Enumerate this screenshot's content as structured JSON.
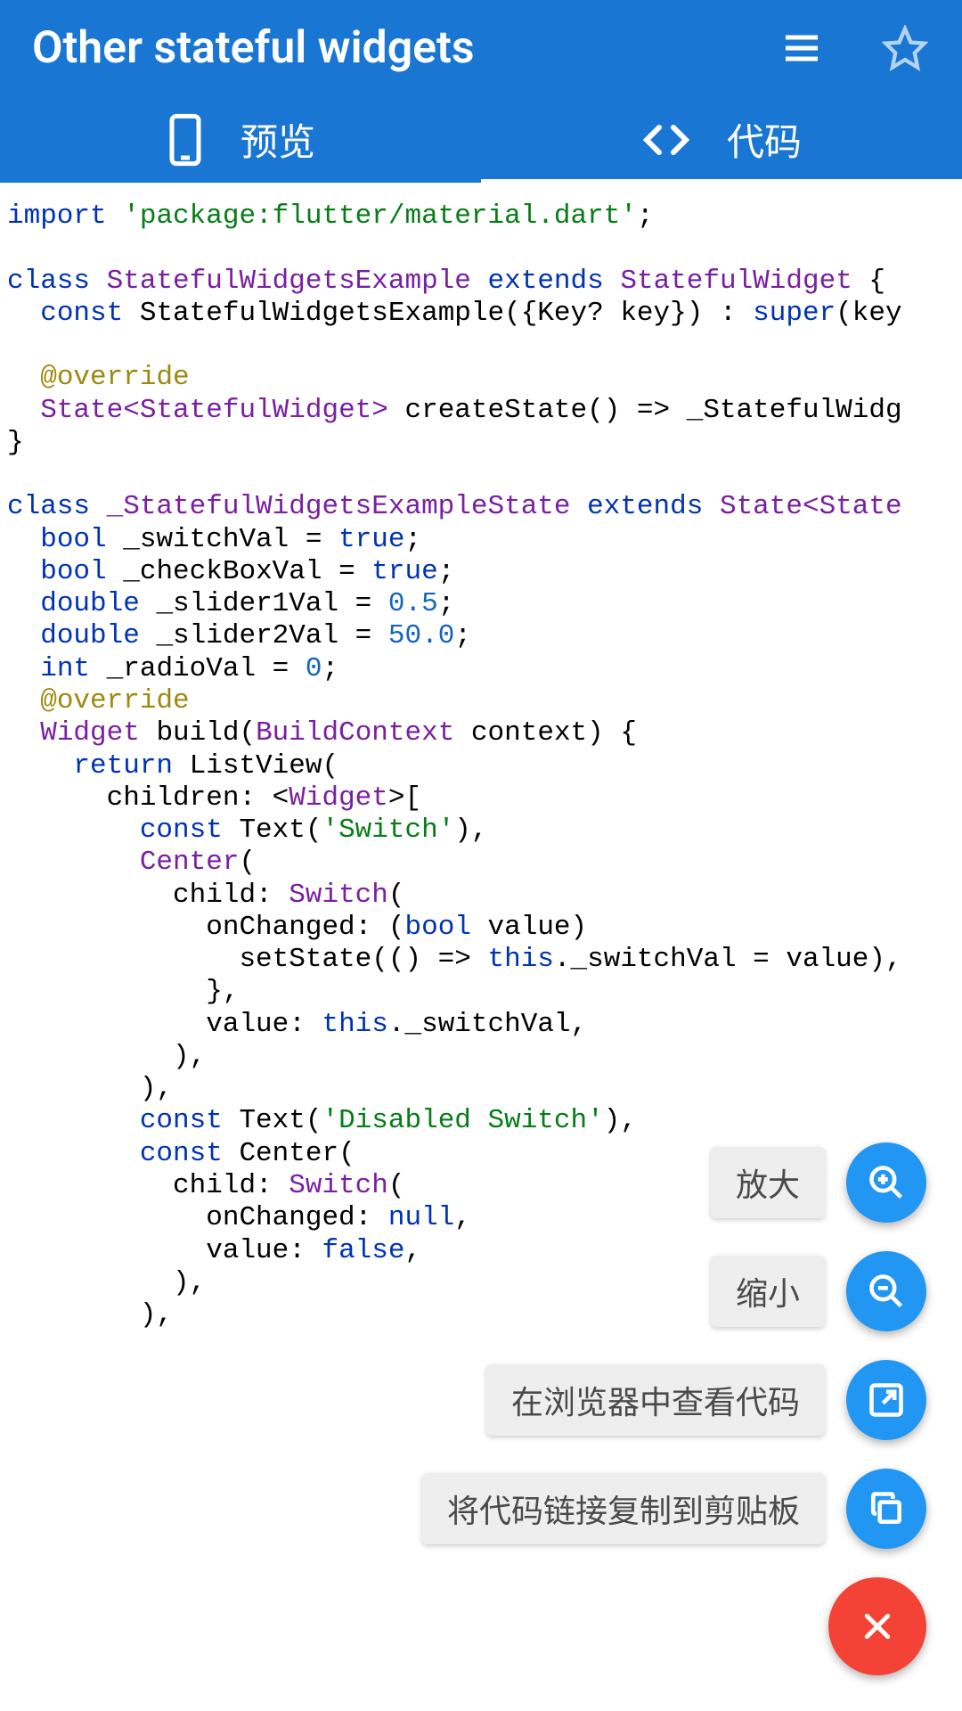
{
  "header": {
    "title": "Other stateful widgets"
  },
  "tabs": {
    "preview_label": "预览",
    "code_label": "代码"
  },
  "fab": {
    "zoom_in": "放大",
    "zoom_out": "缩小",
    "open_browser": "在浏览器中查看代码",
    "copy_link": "将代码链接复制到剪贴板"
  },
  "code": {
    "t_import": "import",
    "t_pkg": "'package:flutter/material.dart'",
    "t_semi": ";",
    "t_class": "class",
    "t_SWE": "StatefulWidgetsExample",
    "t_extends": "extends",
    "t_SW": "StatefulWidget",
    "t_lb": " {",
    "t_const": "const",
    "t_ctor": " StatefulWidgetsExample({Key? key}) : ",
    "t_super": "super",
    "t_key": "(key",
    "t_override": "@override",
    "t_State": "State",
    "t_angSW": "<StatefulWidget>",
    "t_createState": " createState() => _StatefulWidg",
    "t_rb": "}",
    "t_SWES": "_StatefulWidgetsExampleState",
    "t_StateAng": "State<State",
    "t_bool": "bool",
    "t_switchVal": " _switchVal = ",
    "t_true": "true",
    "t_checkBoxVal": " _checkBoxVal = ",
    "t_double": "double",
    "t_slider1": " _slider1Val = ",
    "t_05": "0.5",
    "t_slider2": " _slider2Val = ",
    "t_50": "50.0",
    "t_int": "int",
    "t_radio": " _radioVal = ",
    "t_0": "0",
    "t_Widget": "Widget",
    "t_build": " build(",
    "t_BC": "BuildContext",
    "t_ctx": " context) {",
    "t_return": "return",
    "t_LV": " ListView(",
    "t_children": "      children: <",
    "t_WidgetT": "Widget",
    "t_gtb": ">[",
    "t_Text": " Text(",
    "t_Switch": "'Switch'",
    "t_cp": "),",
    "t_Center": "Center",
    "t_lp": "(",
    "t_child": "          child: ",
    "t_SwitchC": "Switch",
    "t_onCh": "            onChanged: (",
    "t_boolv": "bool",
    "t_value": " value) ",
    "t_setState": "              setState(() => ",
    "t_this": "this",
    "t_sv": "._switchVal = value),",
    "t_cbr": "            },",
    "t_valP": "            value: ",
    "t_thissv": "._switchVal,",
    "t_cp2": "          ),",
    "t_cp3": "        ),",
    "t_DS": "'Disabled Switch'",
    "t_constCenter": "const",
    "t_Center2": " Center(",
    "t_onChNull": "            onChanged: ",
    "t_null": "null",
    "t_c": ",",
    "t_valF": "            value: ",
    "t_false": "false"
  }
}
